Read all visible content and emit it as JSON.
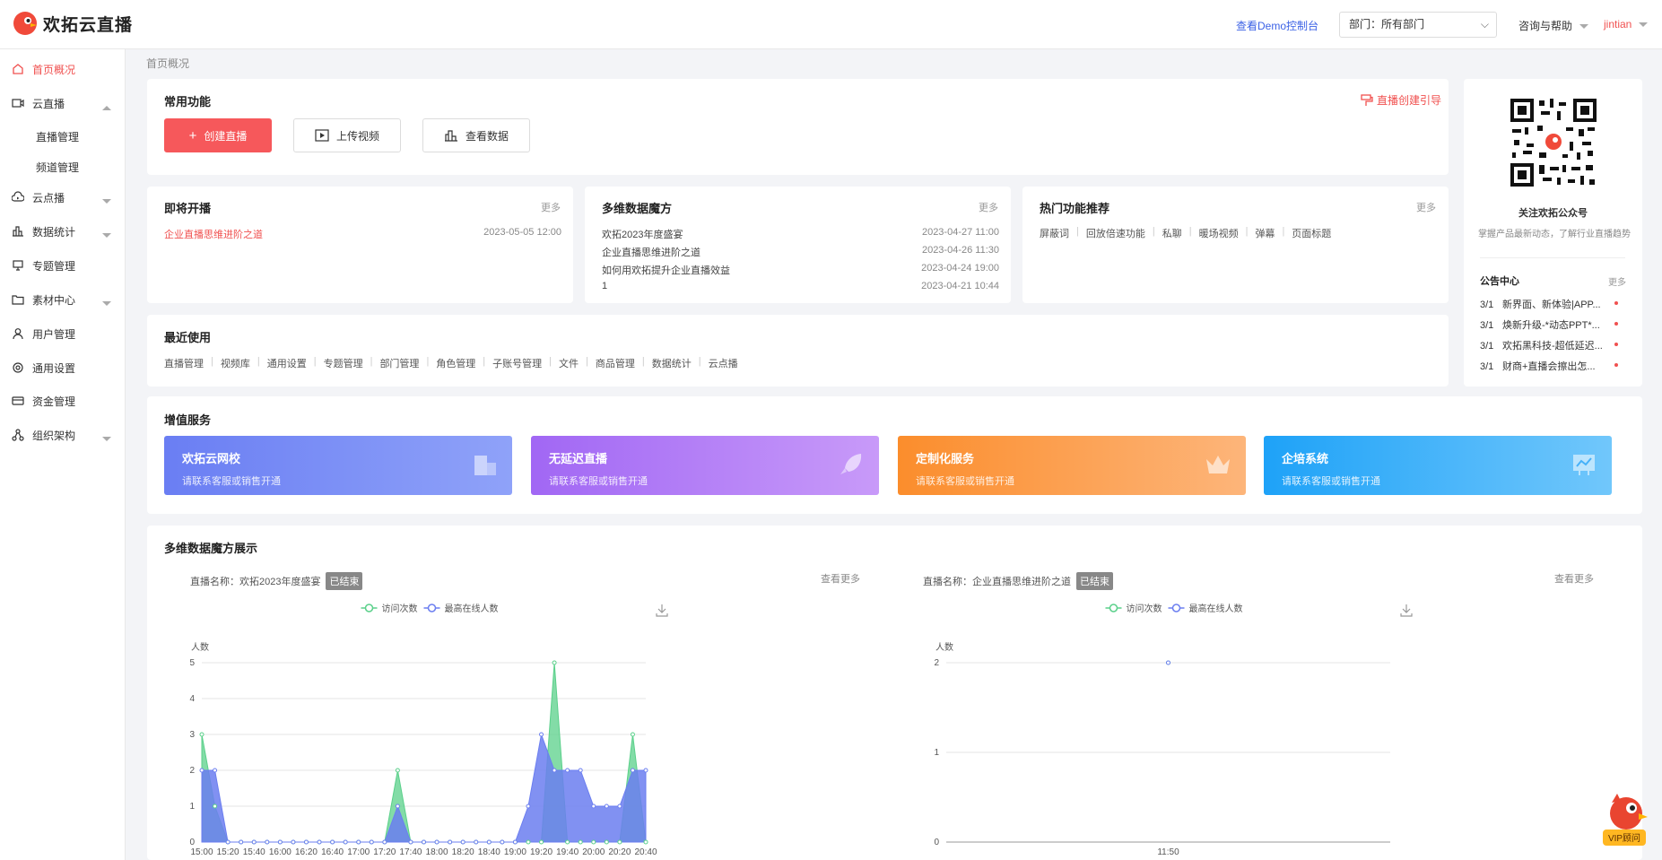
{
  "header": {
    "brand": "欢拓云直播",
    "demo": "查看Demo控制台",
    "dept_label": "部门：所有部门",
    "help": "咨询与帮助",
    "user": "jintian"
  },
  "sidebar": {
    "items": [
      {
        "label": "首页概况",
        "icon": "home-icon"
      },
      {
        "label": "云直播",
        "icon": "video-camera-icon"
      },
      {
        "label": "直播管理"
      },
      {
        "label": "频道管理"
      },
      {
        "label": "云点播",
        "icon": "cloud-play-icon"
      },
      {
        "label": "数据统计",
        "icon": "bar-chart-icon"
      },
      {
        "label": "专题管理",
        "icon": "monitor-icon"
      },
      {
        "label": "素材中心",
        "icon": "folder-icon"
      },
      {
        "label": "用户管理",
        "icon": "user-icon"
      },
      {
        "label": "通用设置",
        "icon": "settings-icon"
      },
      {
        "label": "资金管理",
        "icon": "wallet-icon"
      },
      {
        "label": "组织架构",
        "icon": "org-icon"
      }
    ]
  },
  "breadcrumb": "首页概况",
  "common": {
    "title": "常用功能",
    "create": "创建直播",
    "upload": "上传视频",
    "data": "查看数据",
    "guide": "直播创建引导"
  },
  "upcoming": {
    "title": "即将开播",
    "more": "更多",
    "items": [
      {
        "name": "企业直播思维进阶之道",
        "date": "2023-05-05 12:00"
      }
    ]
  },
  "magic": {
    "title": "多维数据魔方",
    "more": "更多",
    "items": [
      {
        "name": "欢拓2023年度盛宴",
        "date": "2023-04-27 11:00"
      },
      {
        "name": "企业直播思维进阶之道",
        "date": "2023-04-26 11:30"
      },
      {
        "name": "如何用欢拓提升企业直播效益",
        "date": "2023-04-24 19:00"
      },
      {
        "name": "1",
        "date": "2023-04-21 10:44"
      }
    ]
  },
  "hot": {
    "title": "热门功能推荐",
    "more": "更多",
    "items": [
      "屏蔽词",
      "回放倍速功能",
      "私聊",
      "暖场视频",
      "弹幕",
      "页面标题"
    ]
  },
  "recent": {
    "title": "最近使用",
    "items": [
      "直播管理",
      "视频库",
      "通用设置",
      "专题管理",
      "部门管理",
      "角色管理",
      "子账号管理",
      "文件",
      "商品管理",
      "数据统计",
      "云点播"
    ]
  },
  "qr": {
    "title": "关注欢拓公众号",
    "subtitle": "掌握产品最新动态，了解行业直播趋势"
  },
  "notice": {
    "title": "公告中心",
    "more": "更多",
    "items": [
      {
        "date": "3/1",
        "text": "新界面、新体验|APP..."
      },
      {
        "date": "3/1",
        "text": "焕新升级-*动态PPT*..."
      },
      {
        "date": "3/1",
        "text": "欢拓黑科技-超低延迟..."
      },
      {
        "date": "3/1",
        "text": "财商+直播会擦出怎..."
      }
    ]
  },
  "services": {
    "title": "增值服务",
    "items": [
      {
        "title": "欢拓云网校",
        "sub": "请联系客服或销售开通",
        "icon": "building-icon"
      },
      {
        "title": "无延迟直播",
        "sub": "请联系客服或销售开通",
        "icon": "rocket-icon"
      },
      {
        "title": "定制化服务",
        "sub": "请联系客服或销售开通",
        "icon": "crown-icon"
      },
      {
        "title": "企培系统",
        "sub": "请联系客服或销售开通",
        "icon": "chart-board-icon"
      }
    ]
  },
  "charts_section": {
    "title": "多维数据魔方展示",
    "more": "查看更多",
    "status": "已结束",
    "name_prefix": "直播名称："
  },
  "chart_data": [
    {
      "type": "area",
      "live_name": "欢拓2023年度盛宴",
      "ylabel": "人数",
      "ylim": [
        0,
        5
      ],
      "yticks": [
        0,
        1,
        2,
        3,
        4,
        5
      ],
      "xticks": [
        "15:00",
        "15:20",
        "15:40",
        "16:00",
        "16:20",
        "16:40",
        "17:00",
        "17:20",
        "17:40",
        "18:00",
        "18:20",
        "18:40",
        "19:00",
        "19:20",
        "19:40",
        "20:00",
        "20:20",
        "20:40"
      ],
      "series": [
        {
          "name": "访问次数",
          "color": "#5ad08a",
          "values": [
            3,
            1,
            0,
            0,
            0,
            0,
            0,
            0,
            0,
            0,
            0,
            0,
            0,
            0,
            0,
            2,
            0,
            0,
            0,
            0,
            0,
            0,
            0,
            0,
            0,
            0,
            0,
            5,
            0,
            0,
            0,
            0,
            0,
            3,
            0
          ]
        },
        {
          "name": "最高在线人数",
          "color": "#6b7ef0",
          "values": [
            2,
            2,
            0,
            0,
            0,
            0,
            0,
            0,
            0,
            0,
            0,
            0,
            0,
            0,
            0,
            1,
            0,
            0,
            0,
            0,
            0,
            0,
            0,
            0,
            0,
            1,
            3,
            2,
            2,
            2,
            1,
            1,
            1,
            2,
            2
          ]
        }
      ]
    },
    {
      "type": "area",
      "live_name": "企业直播思维进阶之道",
      "ylabel": "人数",
      "ylim": [
        0,
        2
      ],
      "yticks": [
        0,
        1,
        2
      ],
      "xticks": [
        "11:50"
      ],
      "series": [
        {
          "name": "访问次数",
          "color": "#5ad08a",
          "values": [
            2
          ]
        },
        {
          "name": "最高在线人数",
          "color": "#6b7ef0",
          "values": [
            2
          ]
        }
      ]
    }
  ],
  "vip": "VIP顾问"
}
